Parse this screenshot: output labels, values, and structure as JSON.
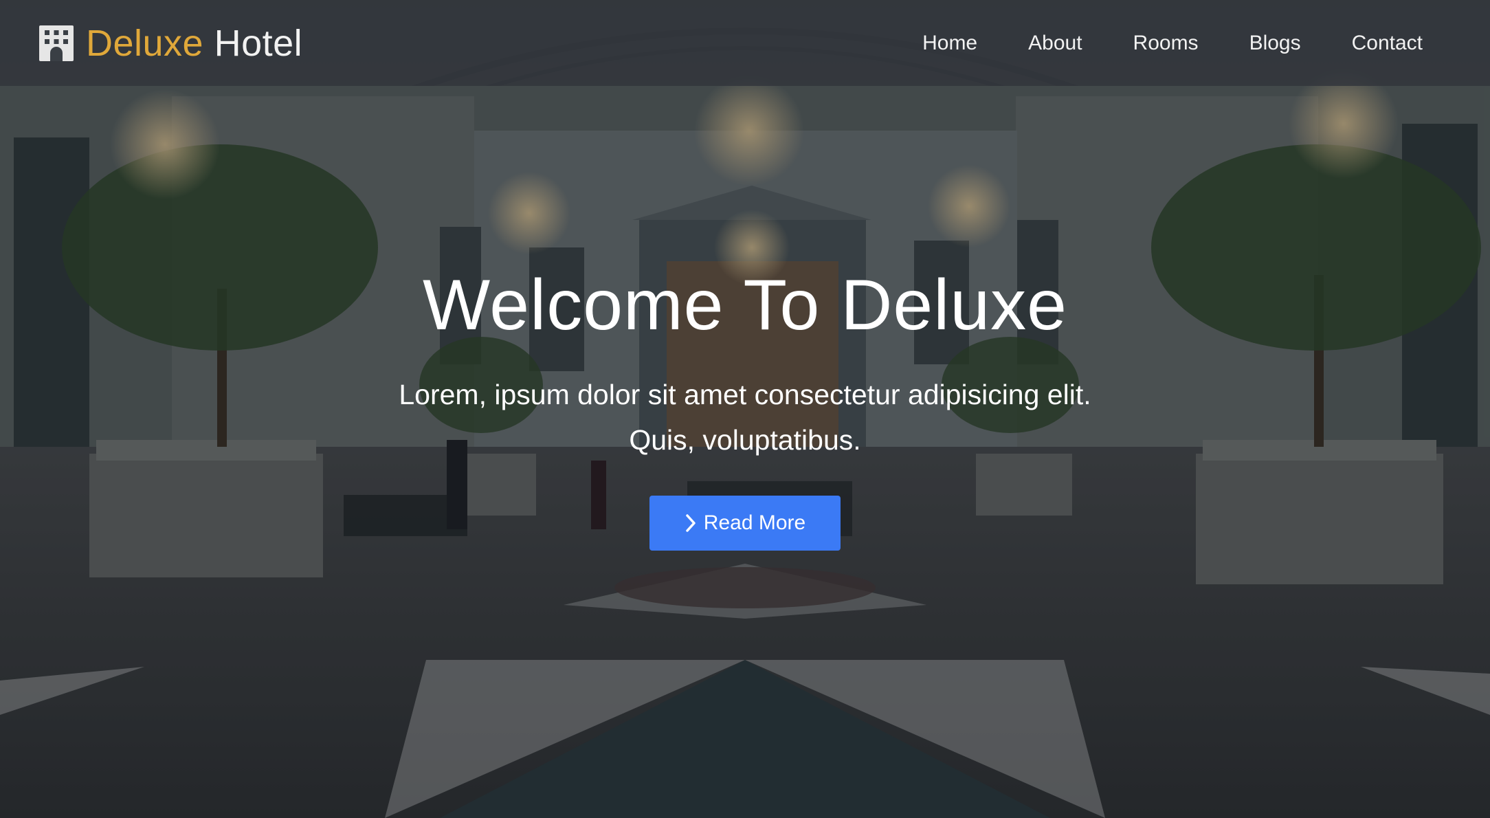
{
  "brand": {
    "accent": "Deluxe",
    "rest": "Hotel",
    "icon": "hotel-building-icon",
    "accent_color": "#e0a83a"
  },
  "nav": {
    "items": [
      "Home",
      "About",
      "Rooms",
      "Blogs",
      "Contact"
    ]
  },
  "hero": {
    "title": "Welcome To Deluxe",
    "subtitle_line1": "Lorem, ipsum dolor sit amet consectetur adipisicing elit.",
    "subtitle_line2": "Quis, voluptatibus.",
    "cta_label": "Read More",
    "cta_icon": "chevron-right-icon",
    "cta_color": "#3b7af5"
  }
}
